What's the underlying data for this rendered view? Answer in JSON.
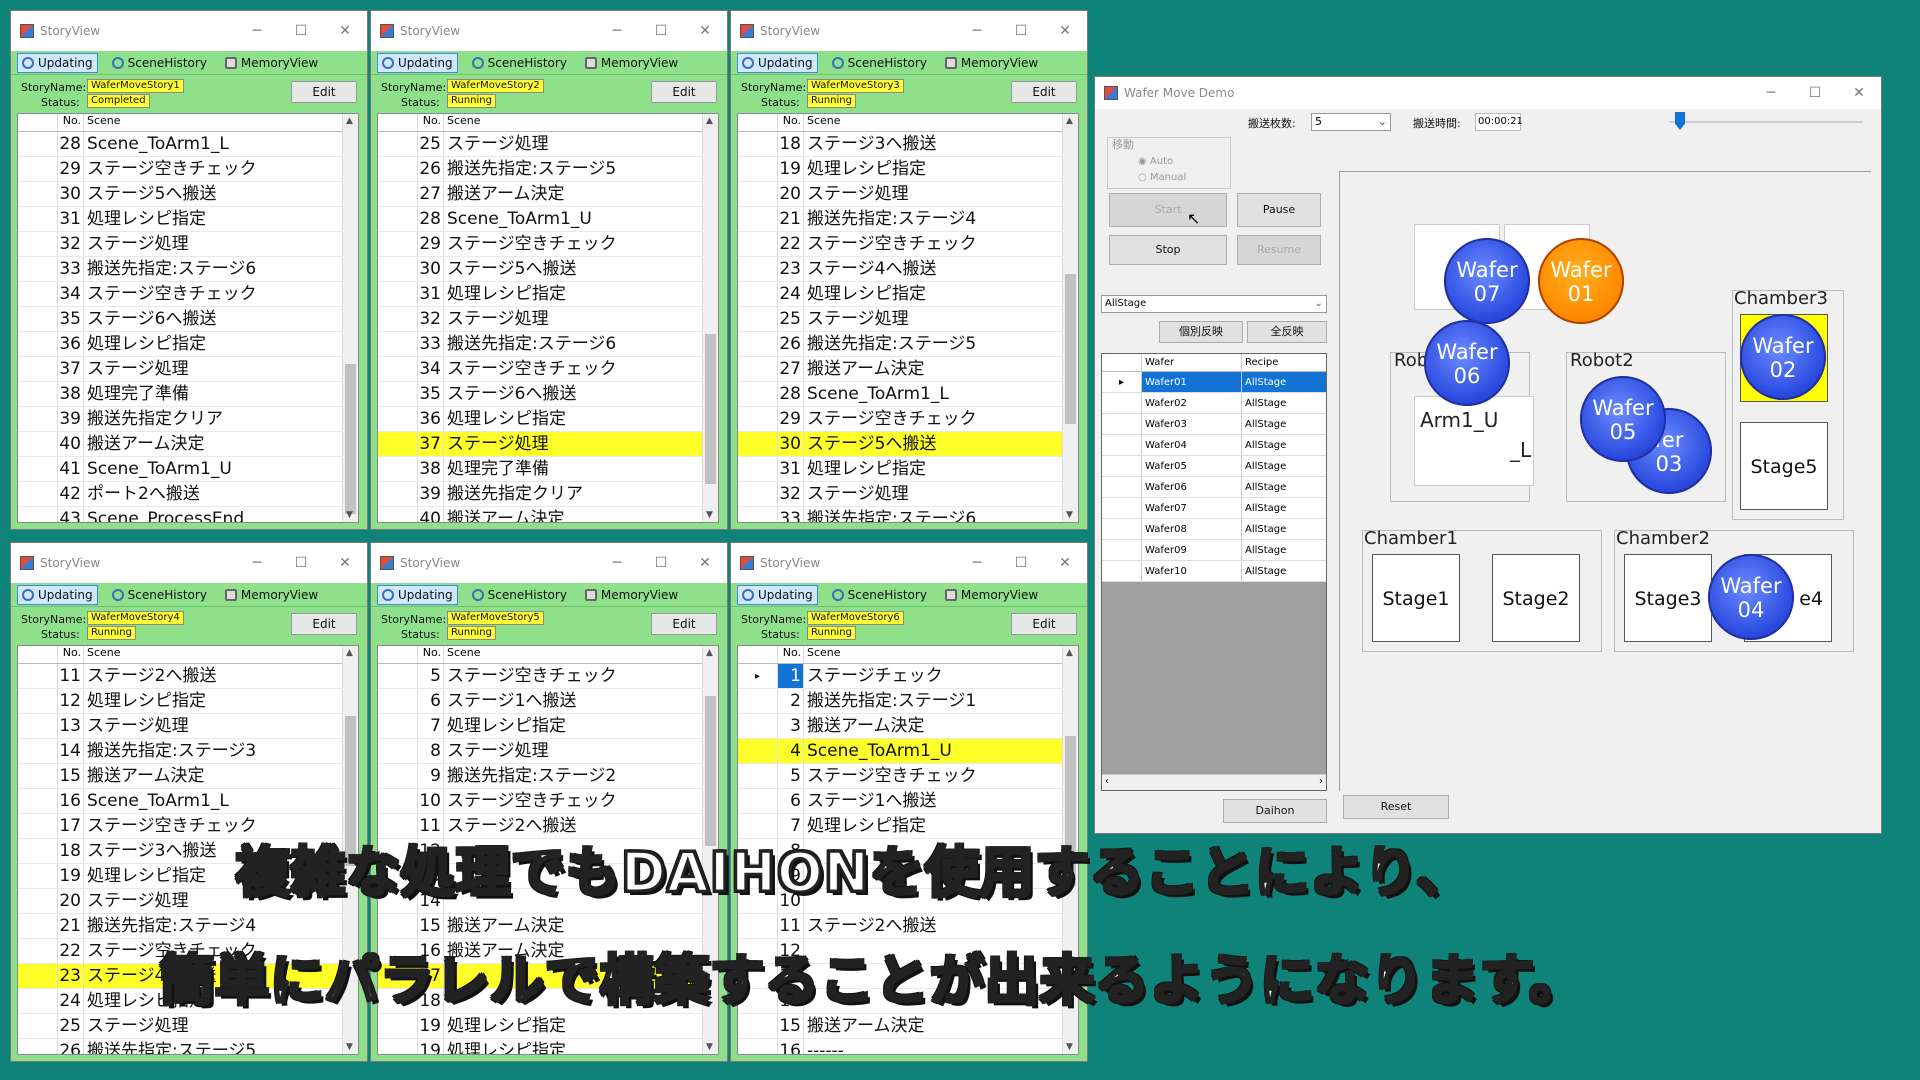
{
  "story_windows": [
    {
      "title": "StoryView",
      "tabs": [
        "Updating",
        "SceneHistory",
        "MemoryView"
      ],
      "storyname_label": "StoryName:",
      "status_label": "Status:",
      "story_name": "WaferMoveStory1",
      "status": "Completed",
      "edit": "Edit",
      "col_no": "No.",
      "col_scene": "Scene",
      "rows": [
        [
          "28",
          "Scene_ToArm1_L"
        ],
        [
          "29",
          "ステージ空きチェック"
        ],
        [
          "30",
          "ステージ5へ搬送"
        ],
        [
          "31",
          "処理レシピ指定"
        ],
        [
          "32",
          "ステージ処理"
        ],
        [
          "33",
          "搬送先指定:ステージ6"
        ],
        [
          "34",
          "ステージ空きチェック"
        ],
        [
          "35",
          "ステージ6へ搬送"
        ],
        [
          "36",
          "処理レシピ指定"
        ],
        [
          "37",
          "ステージ処理"
        ],
        [
          "38",
          "処理完了準備"
        ],
        [
          "39",
          "搬送先指定クリア"
        ],
        [
          "40",
          "搬送アーム決定"
        ],
        [
          "41",
          "Scene_ToArm1_U"
        ],
        [
          "42",
          "ポート2へ搬送"
        ],
        [
          "43",
          "Scene_ProcessEnd"
        ]
      ],
      "highlight": -1
    },
    {
      "title": "StoryView",
      "tabs": [
        "Updating",
        "SceneHistory",
        "MemoryView"
      ],
      "storyname_label": "StoryName:",
      "status_label": "Status:",
      "story_name": "WaferMoveStory2",
      "status": "Running",
      "edit": "Edit",
      "col_no": "No.",
      "col_scene": "Scene",
      "rows": [
        [
          "25",
          "ステージ処理"
        ],
        [
          "26",
          "搬送先指定:ステージ5"
        ],
        [
          "27",
          "搬送アーム決定"
        ],
        [
          "28",
          "Scene_ToArm1_U"
        ],
        [
          "29",
          "ステージ空きチェック"
        ],
        [
          "30",
          "ステージ5へ搬送"
        ],
        [
          "31",
          "処理レシピ指定"
        ],
        [
          "32",
          "ステージ処理"
        ],
        [
          "33",
          "搬送先指定:ステージ6"
        ],
        [
          "34",
          "ステージ空きチェック"
        ],
        [
          "35",
          "ステージ6へ搬送"
        ],
        [
          "36",
          "処理レシピ指定"
        ],
        [
          "37",
          "ステージ処理"
        ],
        [
          "38",
          "処理完了準備"
        ],
        [
          "39",
          "搬送先指定クリア"
        ],
        [
          "40",
          "搬送アーム決定"
        ]
      ],
      "highlight": 12
    },
    {
      "title": "StoryView",
      "tabs": [
        "Updating",
        "SceneHistory",
        "MemoryView"
      ],
      "storyname_label": "StoryName:",
      "status_label": "Status:",
      "story_name": "WaferMoveStory3",
      "status": "Running",
      "edit": "Edit",
      "col_no": "No.",
      "col_scene": "Scene",
      "rows": [
        [
          "18",
          "ステージ3へ搬送"
        ],
        [
          "19",
          "処理レシピ指定"
        ],
        [
          "20",
          "ステージ処理"
        ],
        [
          "21",
          "搬送先指定:ステージ4"
        ],
        [
          "22",
          "ステージ空きチェック"
        ],
        [
          "23",
          "ステージ4へ搬送"
        ],
        [
          "24",
          "処理レシピ指定"
        ],
        [
          "25",
          "ステージ処理"
        ],
        [
          "26",
          "搬送先指定:ステージ5"
        ],
        [
          "27",
          "搬送アーム決定"
        ],
        [
          "28",
          "Scene_ToArm1_L"
        ],
        [
          "29",
          "ステージ空きチェック"
        ],
        [
          "30",
          "ステージ5へ搬送"
        ],
        [
          "31",
          "処理レシピ指定"
        ],
        [
          "32",
          "ステージ処理"
        ],
        [
          "33",
          "搬送先指定:ステージ6"
        ]
      ],
      "highlight": 12
    },
    {
      "title": "StoryView",
      "tabs": [
        "Updating",
        "SceneHistory",
        "MemoryView"
      ],
      "storyname_label": "StoryName:",
      "status_label": "Status:",
      "story_name": "WaferMoveStory4",
      "status": "Running",
      "edit": "Edit",
      "col_no": "No.",
      "col_scene": "Scene",
      "rows": [
        [
          "11",
          "ステージ2へ搬送"
        ],
        [
          "12",
          "処理レシピ指定"
        ],
        [
          "13",
          "ステージ処理"
        ],
        [
          "14",
          "搬送先指定:ステージ3"
        ],
        [
          "15",
          "搬送アーム決定"
        ],
        [
          "16",
          "Scene_ToArm1_L"
        ],
        [
          "17",
          "ステージ空きチェック"
        ],
        [
          "18",
          "ステージ3へ搬送"
        ],
        [
          "19",
          "処理レシピ指定"
        ],
        [
          "20",
          "ステージ処理"
        ],
        [
          "21",
          "搬送先指定:ステージ4"
        ],
        [
          "22",
          "ステージ空きチェック"
        ],
        [
          "23",
          "ステージ4へ搬送"
        ],
        [
          "24",
          "処理レシピ指定"
        ],
        [
          "25",
          "ステージ処理"
        ],
        [
          "26",
          "搬送先指定:ステージ5"
        ]
      ],
      "highlight": 12
    },
    {
      "title": "StoryView",
      "tabs": [
        "Updating",
        "SceneHistory",
        "MemoryView"
      ],
      "storyname_label": "StoryName:",
      "status_label": "Status:",
      "story_name": "WaferMoveStory5",
      "status": "Running",
      "edit": "Edit",
      "col_no": "No.",
      "col_scene": "Scene",
      "rows": [
        [
          "5",
          "ステージ空きチェック"
        ],
        [
          "6",
          "ステージ1へ搬送"
        ],
        [
          "7",
          "処理レシピ指定"
        ],
        [
          "8",
          "ステージ処理"
        ],
        [
          "9",
          "搬送先指定:ステージ2"
        ],
        [
          "10",
          "ステージ空きチェック"
        ],
        [
          "11",
          "ステージ2へ搬送"
        ],
        [
          "12",
          ""
        ],
        [
          "13",
          ""
        ],
        [
          "14",
          ""
        ],
        [
          "15",
          "搬送アーム決定"
        ],
        [
          "16",
          "搬送アーム決定"
        ],
        [
          "17",
          ""
        ],
        [
          "18",
          ""
        ],
        [
          "19",
          "処理レシピ指定"
        ],
        [
          "19",
          "処理レシピ指定"
        ]
      ],
      "highlight": 12
    },
    {
      "title": "StoryView",
      "tabs": [
        "Updating",
        "SceneHistory",
        "MemoryView"
      ],
      "storyname_label": "StoryName:",
      "status_label": "Status:",
      "story_name": "WaferMoveStory6",
      "status": "Running",
      "edit": "Edit",
      "col_no": "No.",
      "col_scene": "Scene",
      "rows": [
        [
          "1",
          "ステージチェック"
        ],
        [
          "2",
          "搬送先指定:ステージ1"
        ],
        [
          "3",
          "搬送アーム決定"
        ],
        [
          "4",
          "Scene_ToArm1_U"
        ],
        [
          "5",
          "ステージ空きチェック"
        ],
        [
          "6",
          "ステージ1へ搬送"
        ],
        [
          "7",
          "処理レシピ指定"
        ],
        [
          "8",
          ""
        ],
        [
          "9",
          ""
        ],
        [
          "10",
          ""
        ],
        [
          "11",
          "ステージ2へ搬送"
        ],
        [
          "12",
          ""
        ],
        [
          "13",
          ""
        ],
        [
          "14",
          ""
        ],
        [
          "15",
          "搬送アーム決定"
        ],
        [
          "16",
          "------"
        ]
      ],
      "highlight": 3
    }
  ],
  "demo": {
    "title": "Wafer Move Demo",
    "count_label": "搬送枚数:",
    "count_value": "5",
    "time_label": "搬送時間:",
    "time_value": "00:00:21",
    "group_move": "移動",
    "radio_auto": "Auto",
    "radio_manual": "Manual",
    "btn_start": "Start",
    "btn_pause": "Pause",
    "btn_stop": "Stop",
    "btn_resume": "Resume",
    "stage_select": "AllStage",
    "btn_individual": "個別反映",
    "btn_all": "全反映",
    "grid_col_wafer": "Wafer",
    "grid_col_recipe": "Recipe",
    "grid_rows": [
      [
        "Wafer01",
        "AllStage"
      ],
      [
        "Wafer02",
        "AllStage"
      ],
      [
        "Wafer03",
        "AllStage"
      ],
      [
        "Wafer04",
        "AllStage"
      ],
      [
        "Wafer05",
        "AllStage"
      ],
      [
        "Wafer06",
        "AllStage"
      ],
      [
        "Wafer07",
        "AllStage"
      ],
      [
        "Wafer08",
        "AllStage"
      ],
      [
        "Wafer09",
        "AllStage"
      ],
      [
        "Wafer10",
        "AllStage"
      ]
    ],
    "btn_daihon": "Daihon",
    "btn_reset": "Reset",
    "labels": {
      "robot1": "Rob",
      "robot2": "Robot2",
      "chamber1": "Chamber1",
      "chamber2": "Chamber2",
      "chamber3": "Chamber3",
      "arm1": "Arm1_U",
      "arm1l": "_L"
    },
    "stages": {
      "s1": "Stage1",
      "s2": "Stage2",
      "s3": "Stage3",
      "s4": "e4",
      "s5": "Stage5"
    },
    "wafers": {
      "w07": [
        "Wafer",
        "07"
      ],
      "w01": [
        "Wafer",
        "01"
      ],
      "w06": [
        "Wafer",
        "06"
      ],
      "w02": [
        "Wafer",
        "02"
      ],
      "w05": [
        "Wafer",
        "05"
      ],
      "w03": [
        "fer",
        "03"
      ],
      "w04": [
        "Wafer",
        "04"
      ]
    },
    "cursor": "↖"
  },
  "subtitle": {
    "line1": "複雑な処理でもDAIHONを使用することにより、",
    "line2": "簡単にパラレルで構築することが出来るようになります。"
  },
  "colors": {
    "background": "#0f8379",
    "window_body": "#8fe08a",
    "highlight": "#ffff2a",
    "wafer_blue": "#2b4be0",
    "wafer_orange": "#ff8a00",
    "selection": "#1273d4"
  }
}
